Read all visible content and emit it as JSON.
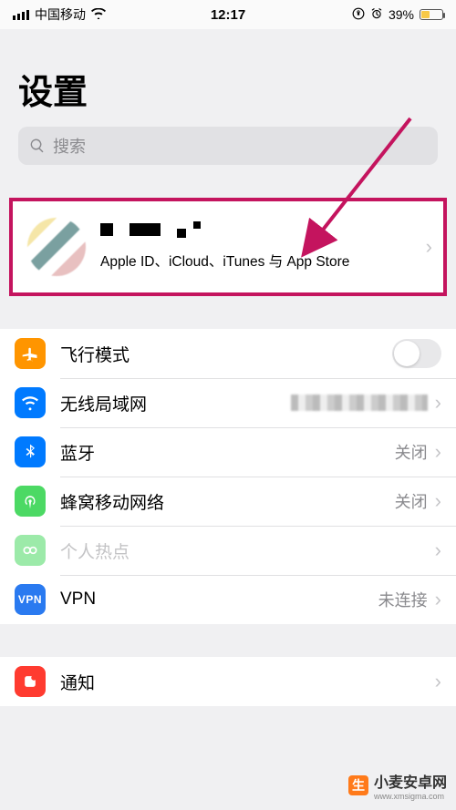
{
  "status_bar": {
    "carrier": "中国移动",
    "time": "12:17",
    "battery_percent": "39%"
  },
  "header": {
    "title": "设置",
    "search_placeholder": "搜索"
  },
  "account": {
    "subtitle": "Apple ID、iCloud、iTunes 与 App Store"
  },
  "rows": {
    "airplane": {
      "label": "飞行模式"
    },
    "wifi": {
      "label": "无线局域网"
    },
    "bluetooth": {
      "label": "蓝牙",
      "value": "关闭"
    },
    "cellular": {
      "label": "蜂窝移动网络",
      "value": "关闭"
    },
    "hotspot": {
      "label": "个人热点"
    },
    "vpn": {
      "label": "VPN",
      "value": "未连接"
    },
    "notifications": {
      "label": "通知"
    }
  },
  "icons": {
    "airplane_color": "#ff9500",
    "wifi_color": "#007aff",
    "bluetooth_color": "#007aff",
    "cellular_color": "#4cd964",
    "hotspot_color": "#4cd964",
    "vpn_color": "#2a7af0",
    "notifications_color": "#ff3b30"
  },
  "watermark": {
    "text": "小麦安卓网",
    "url": "www.xmsigma.com"
  },
  "annotation_arrow_color": "#c4145e"
}
